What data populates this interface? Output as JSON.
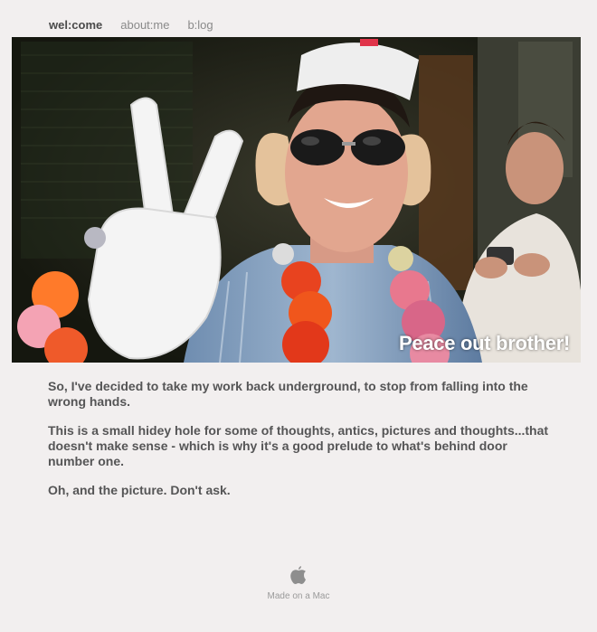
{
  "nav": {
    "items": [
      {
        "label": "wel:come",
        "active": true
      },
      {
        "label": "about:me",
        "active": false
      },
      {
        "label": "b:log",
        "active": false
      }
    ]
  },
  "hero": {
    "caption": "Peace out brother!"
  },
  "content": {
    "paragraphs": [
      "So, I've decided to take my work back underground, to stop from falling into the wrong hands.",
      "This is a small hidey hole for some of thoughts, antics, pictures and thoughts...that doesn't make sense - which is why it's a good prelude to what's behind door number one.",
      "Oh, and the picture.  Don't ask."
    ]
  },
  "footer": {
    "icon": "apple-icon",
    "text": "Made on a Mac"
  },
  "colors": {
    "background": "#f2efef",
    "text": "#555556",
    "nav_inactive": "#8a8a8a",
    "nav_active": "#4a4a4a"
  }
}
